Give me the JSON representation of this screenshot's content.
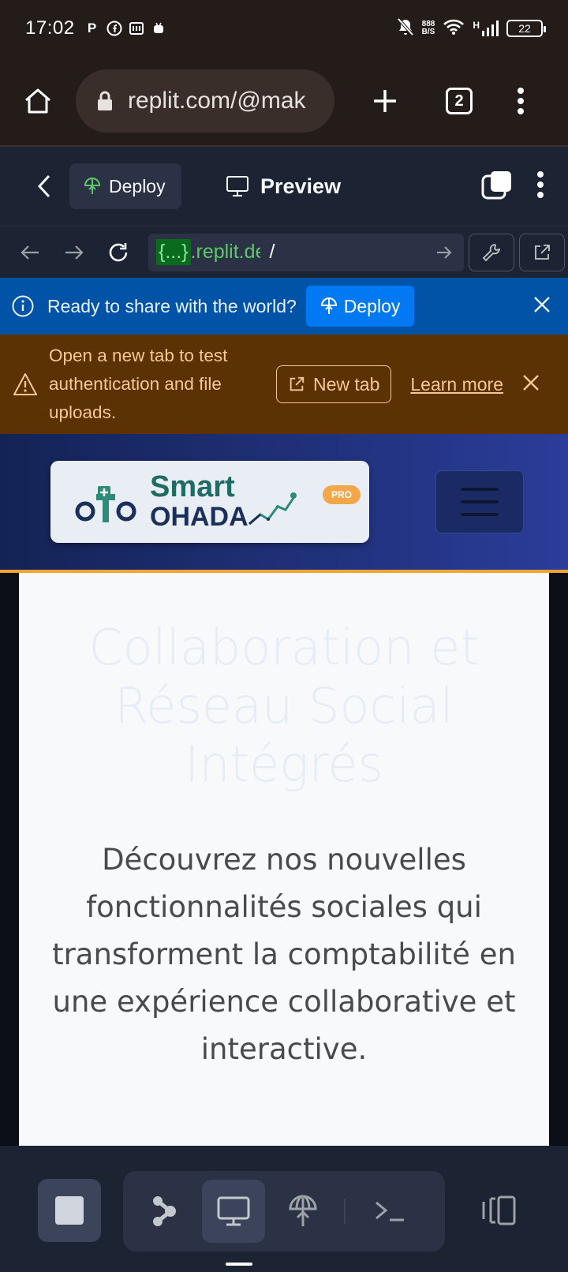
{
  "status_bar": {
    "time": "17:02",
    "net_speed_value": "888",
    "net_speed_unit": "B/S",
    "signal_label": "H",
    "battery": "22"
  },
  "browser": {
    "url": "replit.com/@mak",
    "tab_count": "2"
  },
  "replit_header": {
    "deploy_label": "Deploy",
    "preview_label": "Preview"
  },
  "webview": {
    "host_tag": "{...}",
    "host_rest": ".replit.dev",
    "path": "/"
  },
  "info_banner": {
    "message": "Ready to share with the world?",
    "deploy_label": "Deploy"
  },
  "warning_banner": {
    "message": "Open a new tab to test authentication and file uploads.",
    "new_tab_label": "New tab",
    "learn_more_label": "Learn more"
  },
  "site": {
    "logo_smart": "Smart",
    "logo_ohada": "OHADA",
    "logo_badge": "PRO",
    "hero_title": "Collaboration et Réseau Social Intégrés",
    "hero_description": "Découvrez nos nouvelles fonctionnalités sociales qui transforment la comptabilité en une expérience collaborative et interactive."
  },
  "colors": {
    "replit_bg": "#1c2333",
    "info_banner": "#0053a6",
    "warning_banner": "#5a3204",
    "accent_orange": "#f0a431"
  }
}
